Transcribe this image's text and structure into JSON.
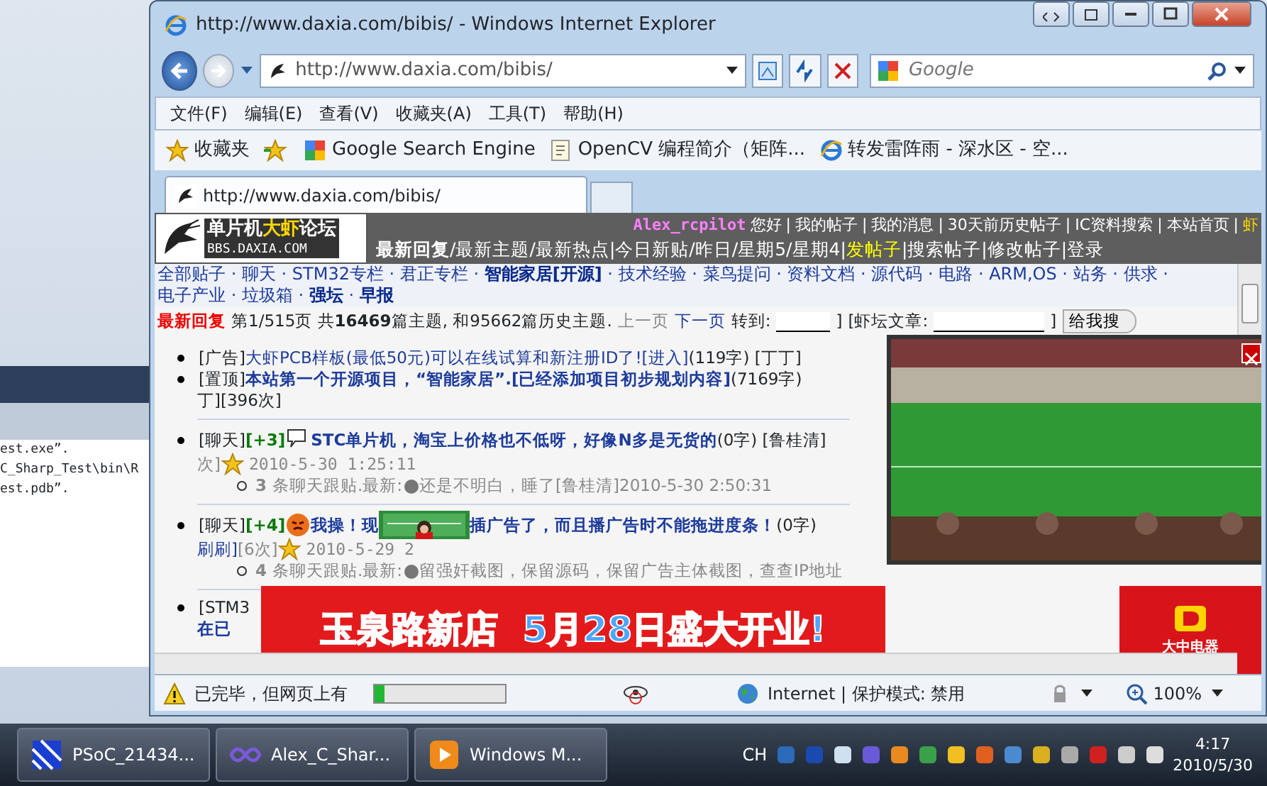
{
  "background_window": {
    "lines": [
      "est.exe”.",
      "C_Sharp_Test\\bin\\R",
      "est.pdb”."
    ]
  },
  "browser": {
    "title": "http://www.daxia.com/bibis/ - Windows Internet Explorer",
    "address": "http://www.daxia.com/bibis/",
    "search": {
      "placeholder": "Google"
    },
    "menu": [
      "文件(F)",
      "编辑(E)",
      "查看(V)",
      "收藏夹(A)",
      "工具(T)",
      "帮助(H)"
    ],
    "favorites": {
      "label": "收藏夹",
      "links": [
        {
          "text": "Google Search Engine",
          "kind": "google"
        },
        {
          "text": "OpenCV 编程简介（矩阵...",
          "kind": "page"
        },
        {
          "text": "转发雷阵雨 - 深水区 - 空...",
          "kind": "ie"
        }
      ]
    },
    "tabs": [
      {
        "label": "http://www.daxia.com/bibis/",
        "selected": true
      }
    ],
    "status": {
      "text": "已完毕，但网页上有",
      "level": 0.08,
      "zone": "Internet | 保护模式: 禁用",
      "zoom": "100%"
    }
  },
  "forum": {
    "logo": {
      "start": "单片机",
      "highlight": "大虾",
      "end": "论坛",
      "domain": "BBS.DAXIA.COM"
    },
    "user": "Alex_rcpilot",
    "greeting": "您好",
    "nav_separator": "|",
    "user_links": [
      "我的帖子",
      "我的消息",
      "30天前历史帖子",
      "IC资料搜索",
      "本站首页",
      "虾"
    ],
    "nav": [
      {
        "text": "最新回复",
        "sep": "/",
        "bold": true,
        "highlight": false
      },
      {
        "text": "最新主题",
        "sep": "/",
        "bold": false,
        "highlight": false
      },
      {
        "text": "最新热点",
        "sep": " | ",
        "bold": false,
        "highlight": false
      },
      {
        "text": "今日新贴",
        "sep": "/ ",
        "bold": false,
        "highlight": false
      },
      {
        "text": "昨日",
        "sep": "/ ",
        "bold": false,
        "highlight": false
      },
      {
        "text": "星期5",
        "sep": "/ ",
        "bold": false,
        "highlight": false
      },
      {
        "text": "星期4",
        "sep": " | ",
        "bold": false,
        "highlight": false
      },
      {
        "text": "发帖子",
        "sep": " | ",
        "bold": false,
        "highlight": true
      },
      {
        "text": "搜索帖子",
        "sep": " | ",
        "bold": false,
        "highlight": false
      },
      {
        "text": "修改帖子",
        "sep": " | ",
        "bold": false,
        "highlight": false
      },
      {
        "text": "登录",
        "bold": false,
        "highlight": false
      }
    ],
    "category_separator": "·",
    "categories": [
      {
        "text": "全部贴子",
        "bold": false
      },
      {
        "text": "聊天",
        "bold": false
      },
      {
        "text": "STM32专栏",
        "bold": false
      },
      {
        "text": "君正专栏",
        "bold": false
      },
      {
        "text": "智能家居[开源]",
        "bold": true
      },
      {
        "text": "技术经验",
        "bold": false
      },
      {
        "text": "菜鸟提问",
        "bold": false
      },
      {
        "text": "资料文档",
        "bold": false
      },
      {
        "text": "源代码",
        "bold": false
      },
      {
        "text": "电路",
        "bold": false
      },
      {
        "text": "ARM,OS",
        "bold": false
      },
      {
        "text": "站务",
        "bold": false
      },
      {
        "text": "供求",
        "bold": false
      },
      {
        "text": "电子产业",
        "bold": false
      },
      {
        "text": "垃圾箱",
        "bold": false
      },
      {
        "text": "强坛",
        "bold": true
      },
      {
        "text": "早报",
        "bold": true
      }
    ],
    "paging": {
      "label": "最新回复",
      "summary": "第1/515页 共**16469**篇主题, 和95662篇历史主题.",
      "prev": {
        "text": "上一页",
        "disabled": true
      },
      "next": {
        "text": "下一页",
        "disabled": false
      },
      "goto": "转到:",
      "bracket": "]",
      "search_label": "[虾坛文章:",
      "search_button": "给我搜"
    },
    "posts": [
      {
        "tag": "[广告]",
        "title": [
          "大虾PCB样板(最低50元)可以在线试算和新注册ID了![进入]"
        ],
        "bold": false,
        "meta": "(119字) [丁丁]"
      },
      {
        "tag": "[置顶]",
        "title": [
          "本站第一个开源项目，“智能家居”.[已经添加项目初步规划内容]"
        ],
        "bold": true,
        "meta": "(7169字)",
        "cont": "丁][396次]"
      },
      {
        "tag": "[聊天]",
        "score": "[+3]",
        "kind": "speech",
        "title": [
          "STC单片机，淘宝上价格也不低呀，好像N多是无货的"
        ],
        "bold": true,
        "meta": "(0字) [鲁桂清]",
        "cont": "次]",
        "date": "2010-5-30 1:25:11",
        "reply_count": "3",
        "reply_label": "条聊天跟贴.最新:",
        "reply_text": "还是不明白，睡了[鲁桂清]2010-5-30 2:50:31"
      },
      {
        "tag": "[聊天]",
        "score": "[+4]",
        "kind": "face",
        "title": [
          "我操！现",
          "插广告了，而且播广告时不能拖进度条！"
        ],
        "bold": true,
        "meta": "(0字)",
        "cont": "刷刷]",
        "cont2": "[6次]",
        "date": "2010-5-29 2",
        "reply_count": "4",
        "reply_label": "条聊天跟贴.最新:",
        "reply_text": "留强奸截图，保留源码，保留广告主体截图，查查IP地址"
      },
      {
        "tag": "[STM3",
        "bold": true,
        "cont": "在已"
      }
    ],
    "banner": "玉泉路新店  5月28日盛大开业!",
    "brand": "大中电器"
  },
  "taskbar": {
    "items": [
      {
        "label": "PSoC_21434...",
        "kind": "psoc"
      },
      {
        "label": "Alex_C_Shar...",
        "kind": "vs"
      },
      {
        "label": "Windows M...",
        "kind": "media"
      }
    ],
    "input": "CH",
    "time": "4:17",
    "date": "2010/5/30"
  }
}
